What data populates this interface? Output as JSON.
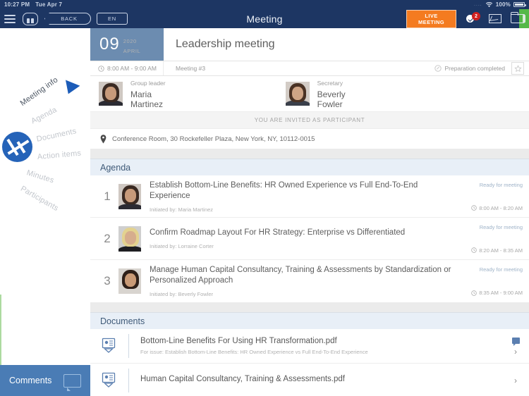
{
  "status_bar": {
    "time": "10:27 PM",
    "date": "Tue Apr 7",
    "battery": "100%",
    "dots": "...."
  },
  "top_bar": {
    "title": "Meeting",
    "back_label": "BACK",
    "lang_label": "EN",
    "live_line1": "LIVE",
    "live_line2": "MEETING",
    "notification_count": "2"
  },
  "sidebar": {
    "items": [
      {
        "label": "Meeting info"
      },
      {
        "label": "Agenda"
      },
      {
        "label": "Documents"
      },
      {
        "label": "Action items"
      },
      {
        "label": "Minutes"
      },
      {
        "label": "Participants"
      }
    ],
    "comments_label": "Comments"
  },
  "meeting": {
    "day": "09",
    "year": "2020",
    "month": "APRIL",
    "title": "Leadership meeting",
    "time_range": "8:00 AM - 9:00 AM",
    "number": "Meeting #3",
    "preparation_status": "Preparation completed",
    "invite_notice": "YOU ARE INVITED AS PARTICIPANT",
    "location": "Conference Room, 30 Rockefeller Plaza, New York, NY, 10112-0015",
    "roles": [
      {
        "role": "Group leader",
        "first": "Maria",
        "last": "Martinez"
      },
      {
        "role": "Secretary",
        "first": "Beverly",
        "last": "Fowler"
      }
    ]
  },
  "agenda": {
    "header": "Agenda",
    "items": [
      {
        "number": "1",
        "title": "Establish Bottom-Line Benefits: HR Owned Experience vs Full End-To-End Experience",
        "initiator": "Initiated by: Maria Martinez",
        "status": "Ready for meeting",
        "time": "8:00 AM - 8:20 AM"
      },
      {
        "number": "2",
        "title": "Confirm Roadmap Layout For HR Strategy: Enterprise vs Differentiated",
        "initiator": "Initiated by: Lorraine Corter",
        "status": "Ready for meeting",
        "time": "8:20 AM - 8:35 AM"
      },
      {
        "number": "3",
        "title": "Manage Human Capital Consultancy, Training & Assessments by Standardization or Personalized Approach",
        "initiator": "Initiated by: Beverly Fowler",
        "status": "Ready for meeting",
        "time": "8:35 AM - 9:00 AM"
      }
    ]
  },
  "documents": {
    "header": "Documents",
    "items": [
      {
        "name": "Bottom-Line Benefits For Using HR Transformation.pdf",
        "subtitle": "For issue: Establish Bottom-Line Benefits: HR Owned Experience vs Full End-To-End Experience"
      },
      {
        "name": "Human Capital Consultancy, Training & Assessments.pdf",
        "subtitle": ""
      }
    ]
  },
  "colors": {
    "navy": "#1d3663",
    "date_block": "#6c8cb0",
    "live_orange": "#f47b20",
    "section_header": "#e8eff7",
    "comments_blue": "#4a7cb5",
    "badge_red": "#d01f1f",
    "green_accent": "#55b848"
  }
}
